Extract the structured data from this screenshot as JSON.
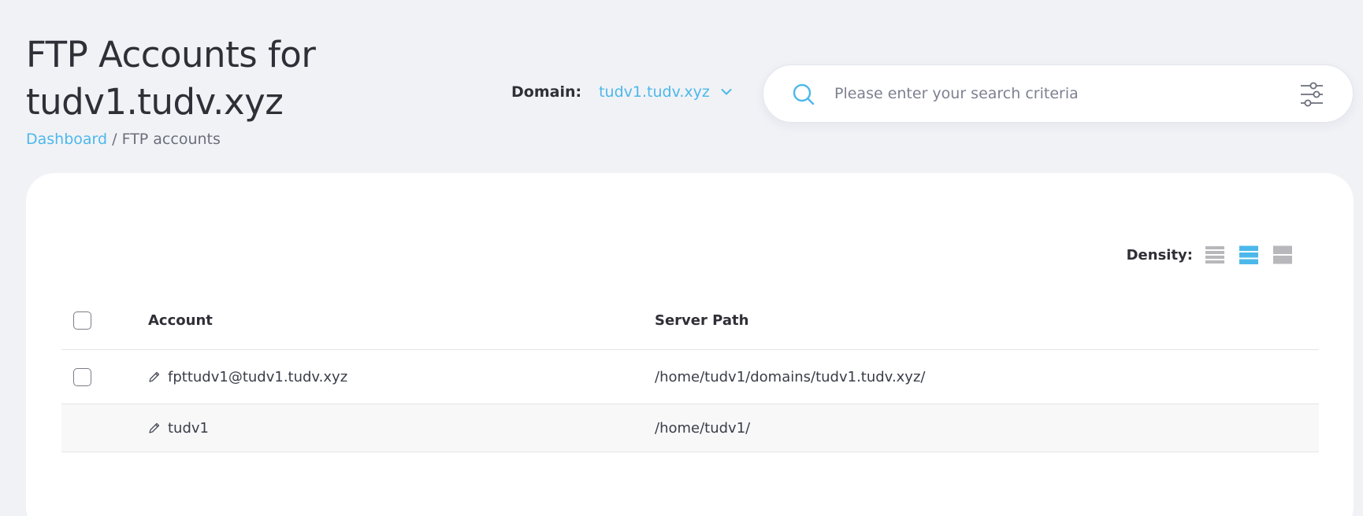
{
  "page": {
    "title_line1": "FTP Accounts for",
    "title_line2": "tudv1.tudv.xyz"
  },
  "breadcrumb": {
    "home": "Dashboard",
    "separator": "/",
    "current": "FTP accounts"
  },
  "domain_select": {
    "label": "Domain:",
    "value": "tudv1.tudv.xyz"
  },
  "search": {
    "placeholder": "Please enter your search criteria",
    "value": ""
  },
  "density": {
    "label": "Density:",
    "options": [
      "compact",
      "standard",
      "comfortable"
    ],
    "selected": "standard"
  },
  "table": {
    "columns": {
      "account": "Account",
      "server_path": "Server Path"
    },
    "rows": [
      {
        "account": "fpttudv1@tudv1.tudv.xyz",
        "server_path": "/home/tudv1/domains/tudv1.tudv.xyz/",
        "selectable": true
      },
      {
        "account": "tudv1",
        "server_path": "/home/tudv1/",
        "selectable": false
      }
    ]
  },
  "colors": {
    "accent": "#4cb8ea",
    "background": "#f1f2f6",
    "card": "#ffffff",
    "text": "#2f2f37",
    "muted_icon": "#b8b8bc"
  },
  "icons": {
    "search": "search-icon",
    "filter": "sliders-icon",
    "dropdown": "chevron-down-icon",
    "edit": "pencil-icon"
  }
}
